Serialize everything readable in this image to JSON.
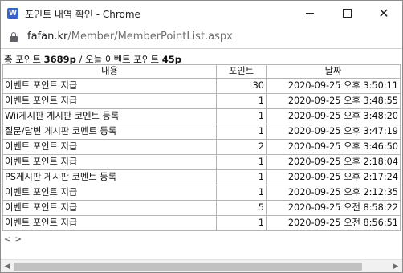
{
  "window": {
    "title": "포인트 내역 확인 - Chrome",
    "app_icon": "W"
  },
  "address_bar": {
    "host": "fafan.kr",
    "path": "/Member/MemberPointList.aspx"
  },
  "summary": {
    "total_label": "총 포인트",
    "total_value": "3689p",
    "separator": "/",
    "today_label": "오늘 이벤트 포인트",
    "today_value": "45p"
  },
  "table": {
    "headers": [
      "내용",
      "포인트",
      "날짜"
    ],
    "rows": [
      {
        "content": "이벤트 포인트 지급",
        "point": "30",
        "date": "2020-09-25 오후 3:50:11"
      },
      {
        "content": "이벤트 포인트 지급",
        "point": "1",
        "date": "2020-09-25 오후 3:48:55"
      },
      {
        "content": "Wii게시판 게시판 코멘트 등록",
        "point": "1",
        "date": "2020-09-25 오후 3:48:20"
      },
      {
        "content": "질문/답변 게시판 코멘트 등록",
        "point": "1",
        "date": "2020-09-25 오후 3:47:19"
      },
      {
        "content": "이벤트 포인트 지급",
        "point": "2",
        "date": "2020-09-25 오후 3:46:50"
      },
      {
        "content": "이벤트 포인트 지급",
        "point": "1",
        "date": "2020-09-25 오후 2:18:04"
      },
      {
        "content": "PS게시판 게시판 코멘트 등록",
        "point": "1",
        "date": "2020-09-25 오후 2:17:24"
      },
      {
        "content": "이벤트 포인트 지급",
        "point": "1",
        "date": "2020-09-25 오후 2:12:35"
      },
      {
        "content": "이벤트 포인트 지급",
        "point": "5",
        "date": "2020-09-25 오전 8:58:22"
      },
      {
        "content": "이벤트 포인트 지급",
        "point": "1",
        "date": "2020-09-25 오전 8:56:51"
      }
    ]
  },
  "pager": {
    "prev": "<",
    "next": ">"
  },
  "icons": {
    "minimize": "minimize-icon",
    "maximize": "maximize-icon",
    "close": "close-icon",
    "lock": "lock-icon",
    "scroll_left": "scroll-left-arrow-icon",
    "scroll_right": "scroll-right-arrow-icon"
  },
  "colors": {
    "app_icon_bg": "#3a64c8",
    "url_host": "#202124",
    "url_path": "#6e6e6e",
    "grid_border": "#b5b5b5",
    "scrollbar_thumb": "#c1c1c1"
  }
}
